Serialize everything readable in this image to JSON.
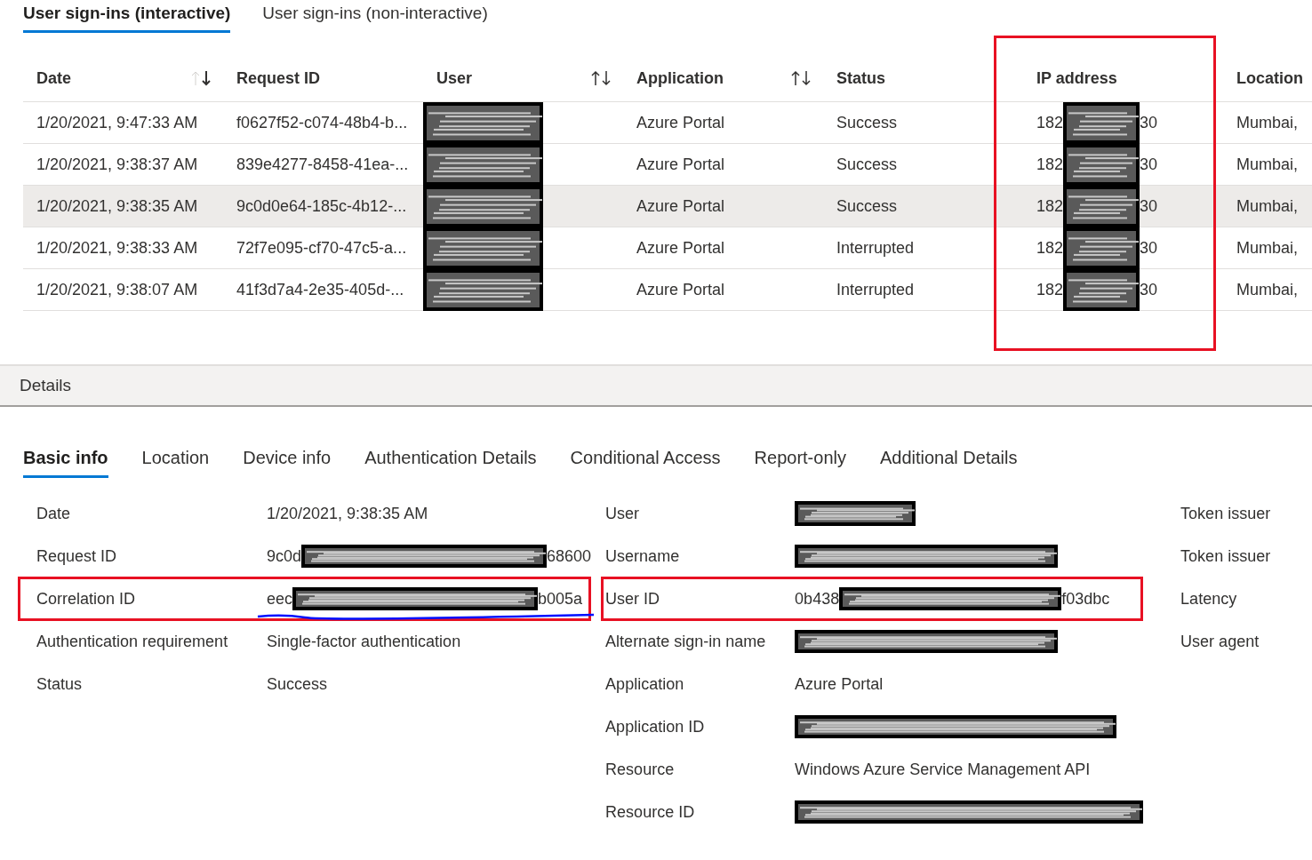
{
  "tabs": [
    {
      "label": "User sign-ins (interactive)",
      "selected": true
    },
    {
      "label": "User sign-ins (non-interactive)",
      "selected": false
    }
  ],
  "table": {
    "columns": [
      {
        "label": "Date",
        "sort_icon": true,
        "sorted": true
      },
      {
        "label": "Request ID",
        "sort_icon": false
      },
      {
        "label": "User",
        "sort_icon": true,
        "sorted": false
      },
      {
        "label": "Application",
        "sort_icon": true,
        "sorted": false
      },
      {
        "label": "Status",
        "sort_icon": false
      },
      {
        "label": "IP address",
        "sort_icon": false,
        "highlighted": true
      },
      {
        "label": "Location",
        "sort_icon": false
      }
    ],
    "rows": [
      {
        "selected": false,
        "date": "1/20/2021, 9:47:33 AM",
        "request_id": "f0627f52-c074-48b4-b...",
        "user": {
          "redacted": true
        },
        "application": "Azure Portal",
        "status": "Success",
        "ip": {
          "prefix": "182",
          "suffix": "30"
        },
        "location": "Mumbai,"
      },
      {
        "selected": false,
        "date": "1/20/2021, 9:38:37 AM",
        "request_id": "839e4277-8458-41ea-...",
        "user": {
          "redacted": true
        },
        "application": "Azure Portal",
        "status": "Success",
        "ip": {
          "prefix": "182",
          "suffix": "30"
        },
        "location": "Mumbai,"
      },
      {
        "selected": true,
        "date": "1/20/2021, 9:38:35 AM",
        "request_id": "9c0d0e64-185c-4b12-...",
        "user": {
          "redacted": true
        },
        "application": "Azure Portal",
        "status": "Success",
        "ip": {
          "prefix": "182",
          "suffix": "30"
        },
        "location": "Mumbai,"
      },
      {
        "selected": false,
        "date": "1/20/2021, 9:38:33 AM",
        "request_id": "72f7e095-cf70-47c5-a...",
        "user": {
          "redacted": true
        },
        "application": "Azure Portal",
        "status": "Interrupted",
        "ip": {
          "prefix": "182",
          "suffix": "30"
        },
        "location": "Mumbai,"
      },
      {
        "selected": false,
        "date": "1/20/2021, 9:38:07 AM",
        "request_id": "41f3d7a4-2e35-405d-...",
        "user": {
          "redacted": true
        },
        "application": "Azure Portal",
        "status": "Interrupted",
        "ip": {
          "prefix": "182",
          "suffix": "30"
        },
        "location": "Mumbai,"
      }
    ]
  },
  "details": {
    "title": "Details",
    "tabs": [
      {
        "label": "Basic info",
        "selected": true
      },
      {
        "label": "Location",
        "selected": false
      },
      {
        "label": "Device info",
        "selected": false
      },
      {
        "label": "Authentication Details",
        "selected": false
      },
      {
        "label": "Conditional Access",
        "selected": false
      },
      {
        "label": "Report-only",
        "selected": false
      },
      {
        "label": "Additional Details",
        "selected": false
      }
    ],
    "sections": [
      [
        {
          "label": "Date",
          "kind": "text",
          "value": "1/20/2021, 9:38:35 AM"
        },
        {
          "label": "Request ID",
          "kind": "partial",
          "prefix": "9c0d",
          "suffix": "68600"
        },
        {
          "label": "Correlation ID",
          "kind": "partial",
          "prefix": "eec",
          "suffix": "b005a",
          "highlighted": true,
          "underlined": true
        },
        {
          "label": "Authentication requirement",
          "kind": "text",
          "value": "Single-factor authentication"
        },
        {
          "label": "Status",
          "kind": "text",
          "value": "Success"
        }
      ],
      [
        {
          "label": "User",
          "kind": "redacted_link"
        },
        {
          "label": "Username",
          "kind": "redacted"
        },
        {
          "label": "User ID",
          "kind": "partial",
          "prefix": "0b438",
          "suffix": "f03dbc",
          "highlighted": true
        },
        {
          "label": "Alternate sign-in name",
          "kind": "redacted"
        },
        {
          "label": "Application",
          "kind": "text",
          "value": "Azure Portal"
        },
        {
          "label": "Application ID",
          "kind": "redacted"
        },
        {
          "label": "Resource",
          "kind": "text",
          "value": "Windows Azure Service Management API"
        },
        {
          "label": "Resource ID",
          "kind": "redacted"
        }
      ],
      [
        {
          "label": "Token issuer",
          "kind": "label_only"
        },
        {
          "label": "Token issuer",
          "kind": "label_only"
        },
        {
          "label": "Latency",
          "kind": "label_only"
        },
        {
          "label": "User agent",
          "kind": "label_only"
        }
      ]
    ]
  }
}
